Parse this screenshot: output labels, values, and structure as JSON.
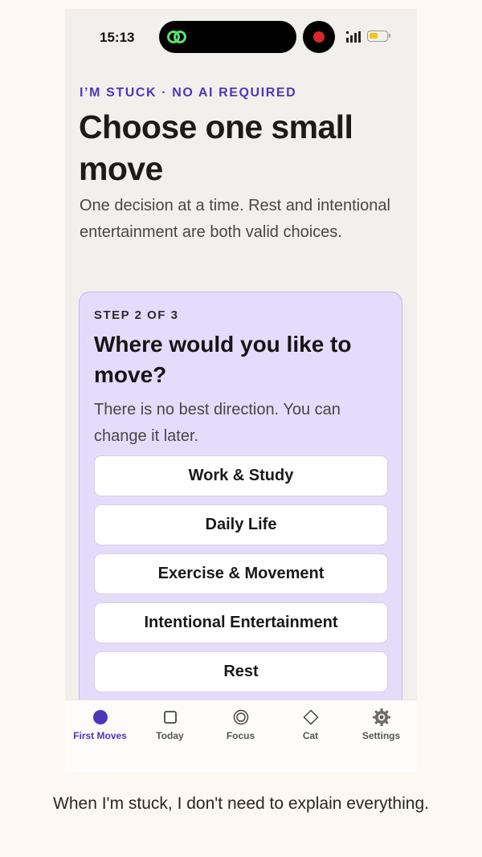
{
  "status_bar": {
    "time": "15:13"
  },
  "header": {
    "eyebrow": "I’M STUCK · NO AI REQUIRED",
    "title": "Choose one small move",
    "subtitle": "One decision at a time. Rest and intentional entertainment are both valid choices."
  },
  "step_card": {
    "step_label": "STEP 2 OF 3",
    "question": "Where would you like to move?",
    "hint": "There is no best direction. You can change it later.",
    "options": [
      "Work & Study",
      "Daily Life",
      "Exercise & Movement",
      "Intentional Entertainment",
      "Rest"
    ]
  },
  "tab_bar": {
    "tabs": [
      {
        "label": "First Moves",
        "icon": "filled-circle-icon",
        "active": true
      },
      {
        "label": "Today",
        "icon": "square-icon"
      },
      {
        "label": "Focus",
        "icon": "target-icon"
      },
      {
        "label": "Cat",
        "icon": "diamond-icon"
      },
      {
        "label": "Settings",
        "icon": "gear-icon"
      }
    ]
  },
  "caption": "When I'm stuck, I don't need to explain everything.",
  "colors": {
    "accent": "#4b37b8",
    "card_background": "#e4dcfb",
    "record_dot": "#d9262b",
    "battery": "#f3c31c"
  }
}
